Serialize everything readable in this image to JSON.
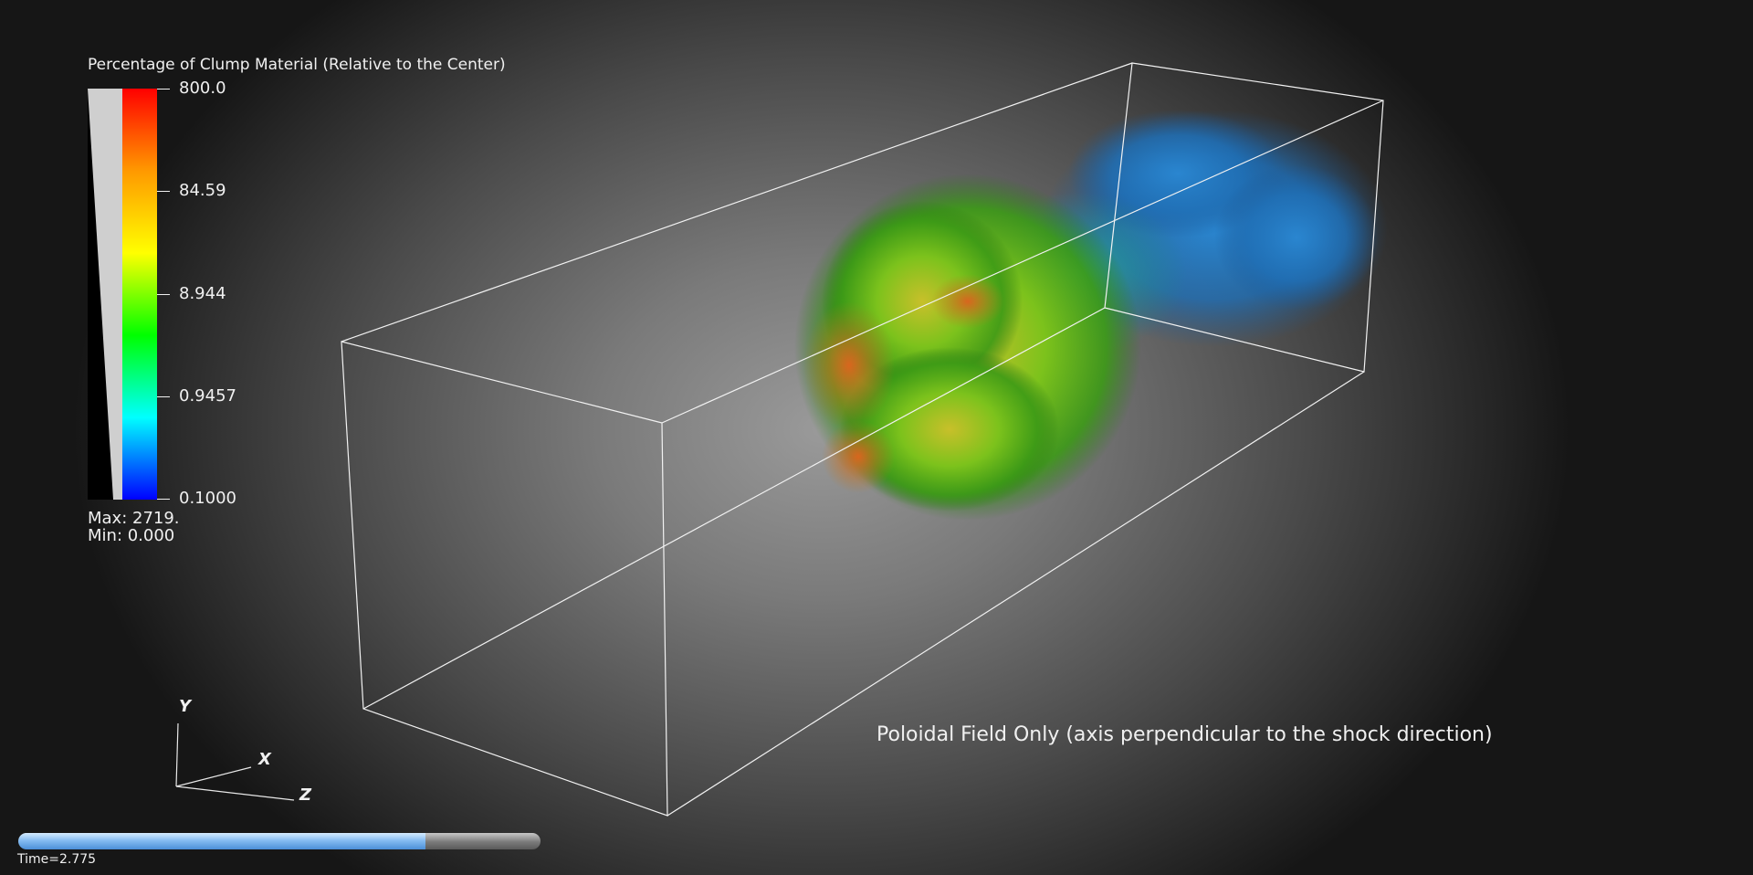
{
  "legend": {
    "title": "Percentage of Clump Material (Relative to the Center)",
    "ticks": [
      "800.0",
      "84.59",
      "8.944",
      "0.9457",
      "0.1000"
    ],
    "max_label": "Max:  2719.",
    "min_label": "Min:  0.000",
    "colors": [
      "#ff0000",
      "#ff9900",
      "#ffff00",
      "#00ff00",
      "#00ffff",
      "#0000ff"
    ]
  },
  "caption": "Poloidal Field Only (axis perpendicular to the shock direction)",
  "axes": {
    "x": "X",
    "y": "Y",
    "z": "Z"
  },
  "time": {
    "label": "Time=2.775",
    "progress": 0.78
  }
}
